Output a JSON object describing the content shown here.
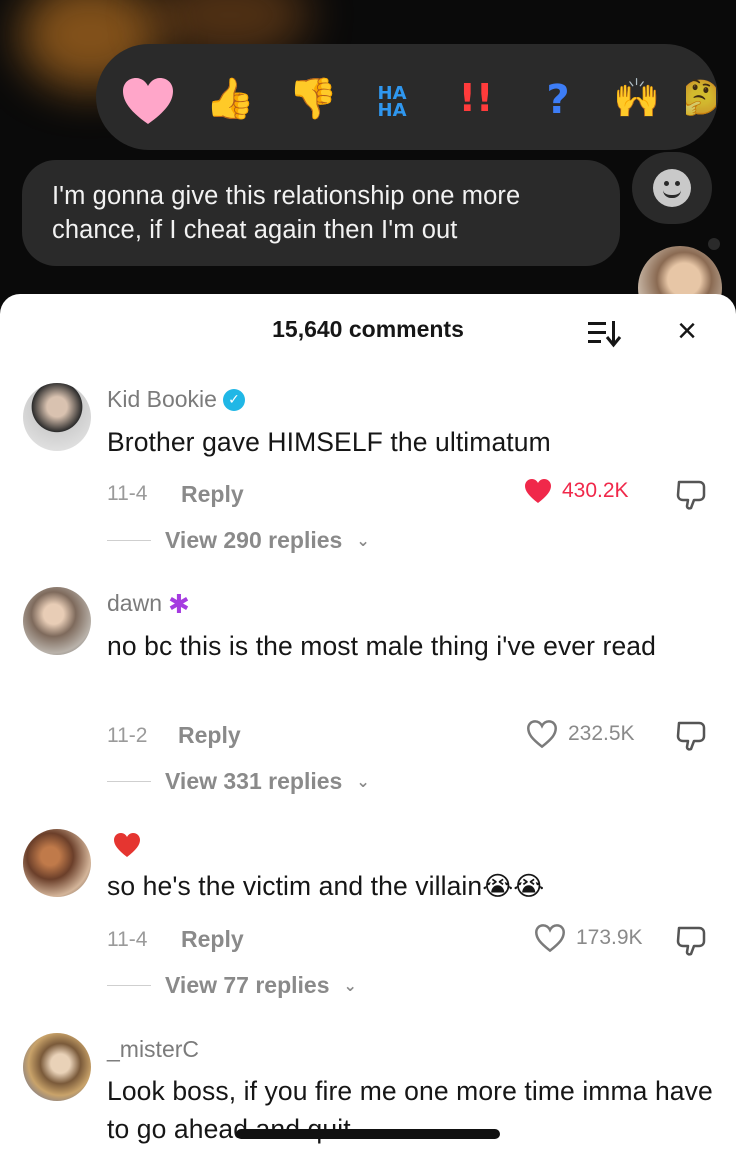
{
  "video": {
    "reactions": [
      "heart",
      "thumbs-up",
      "thumbs-down",
      "HA HA",
      "!!",
      "?",
      "raised-hands",
      "more"
    ],
    "haha_line1": "HA",
    "haha_line2": "HA",
    "exclaim": "!!",
    "question": "?",
    "message": "I'm gonna give this relationship one more chance, if I cheat again then I'm out"
  },
  "sheet": {
    "title": "15,640 comments",
    "close_glyph": "×"
  },
  "comments": [
    {
      "username": "Kid Bookie",
      "verified": true,
      "text": "Brother gave HIMSELF the ultimatum",
      "date": "11-4",
      "reply_label": "Reply",
      "likes": "430.2K",
      "liked": true,
      "view_replies": "View 290 replies"
    },
    {
      "username": "dawn",
      "badge": "✱",
      "text": "no bc this is the most male thing i've ever read",
      "date": "11-2",
      "reply_label": "Reply",
      "likes": "232.5K",
      "liked": false,
      "view_replies": "View 331 replies"
    },
    {
      "username": "",
      "text": "so he's the victim and the villain😭😭",
      "date": "11-4",
      "reply_label": "Reply",
      "likes": "173.9K",
      "liked": false,
      "view_replies": "View 77 replies"
    },
    {
      "username": "_misterC",
      "text": "Look boss, if you fire me one more time imma have to go ahead and quit"
    }
  ],
  "colors": {
    "accent_like": "#f0284a",
    "verified": "#20b7e6",
    "muted": "#8a8a8a"
  }
}
